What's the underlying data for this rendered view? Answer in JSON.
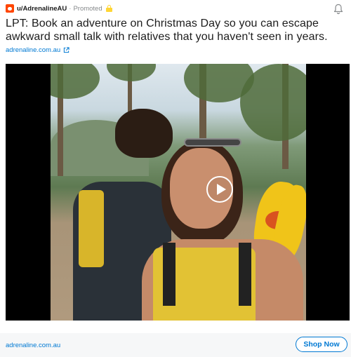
{
  "post": {
    "username": "u/AdrenalineAU",
    "separator": "·",
    "promoted_label": "Promoted",
    "title": "LPT: Book an adventure on Christmas Day so you can escape awkward small talk with relatives that you haven't seen in years.",
    "domain_link": "adrenaline.com.au",
    "icons": {
      "avatar": "reddit-avatar-icon",
      "promoted_badge": "lock-icon",
      "notification": "bell-icon",
      "external_link": "external-link-icon",
      "play": "play-icon"
    }
  },
  "footer": {
    "domain_link": "adrenaline.com.au",
    "cta_label": "Shop Now"
  },
  "colors": {
    "link_blue": "#0079d3",
    "reddit_orange": "#ff4500",
    "badge_yellow": "#ffd635",
    "footer_bg": "#f6f7f8"
  }
}
